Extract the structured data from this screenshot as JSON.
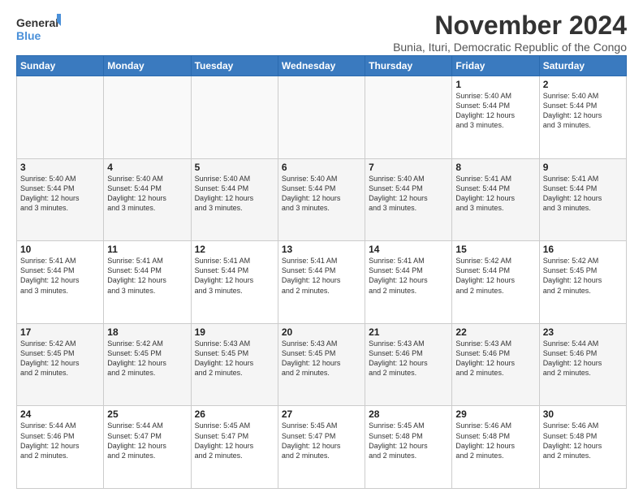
{
  "logo": {
    "line1": "General",
    "line2": "Blue"
  },
  "title": "November 2024",
  "subtitle": "Bunia, Ituri, Democratic Republic of the Congo",
  "days_of_week": [
    "Sunday",
    "Monday",
    "Tuesday",
    "Wednesday",
    "Thursday",
    "Friday",
    "Saturday"
  ],
  "weeks": [
    [
      {
        "day": "",
        "info": ""
      },
      {
        "day": "",
        "info": ""
      },
      {
        "day": "",
        "info": ""
      },
      {
        "day": "",
        "info": ""
      },
      {
        "day": "",
        "info": ""
      },
      {
        "day": "1",
        "info": "Sunrise: 5:40 AM\nSunset: 5:44 PM\nDaylight: 12 hours\nand 3 minutes."
      },
      {
        "day": "2",
        "info": "Sunrise: 5:40 AM\nSunset: 5:44 PM\nDaylight: 12 hours\nand 3 minutes."
      }
    ],
    [
      {
        "day": "3",
        "info": "Sunrise: 5:40 AM\nSunset: 5:44 PM\nDaylight: 12 hours\nand 3 minutes."
      },
      {
        "day": "4",
        "info": "Sunrise: 5:40 AM\nSunset: 5:44 PM\nDaylight: 12 hours\nand 3 minutes."
      },
      {
        "day": "5",
        "info": "Sunrise: 5:40 AM\nSunset: 5:44 PM\nDaylight: 12 hours\nand 3 minutes."
      },
      {
        "day": "6",
        "info": "Sunrise: 5:40 AM\nSunset: 5:44 PM\nDaylight: 12 hours\nand 3 minutes."
      },
      {
        "day": "7",
        "info": "Sunrise: 5:40 AM\nSunset: 5:44 PM\nDaylight: 12 hours\nand 3 minutes."
      },
      {
        "day": "8",
        "info": "Sunrise: 5:41 AM\nSunset: 5:44 PM\nDaylight: 12 hours\nand 3 minutes."
      },
      {
        "day": "9",
        "info": "Sunrise: 5:41 AM\nSunset: 5:44 PM\nDaylight: 12 hours\nand 3 minutes."
      }
    ],
    [
      {
        "day": "10",
        "info": "Sunrise: 5:41 AM\nSunset: 5:44 PM\nDaylight: 12 hours\nand 3 minutes."
      },
      {
        "day": "11",
        "info": "Sunrise: 5:41 AM\nSunset: 5:44 PM\nDaylight: 12 hours\nand 3 minutes."
      },
      {
        "day": "12",
        "info": "Sunrise: 5:41 AM\nSunset: 5:44 PM\nDaylight: 12 hours\nand 3 minutes."
      },
      {
        "day": "13",
        "info": "Sunrise: 5:41 AM\nSunset: 5:44 PM\nDaylight: 12 hours\nand 2 minutes."
      },
      {
        "day": "14",
        "info": "Sunrise: 5:41 AM\nSunset: 5:44 PM\nDaylight: 12 hours\nand 2 minutes."
      },
      {
        "day": "15",
        "info": "Sunrise: 5:42 AM\nSunset: 5:44 PM\nDaylight: 12 hours\nand 2 minutes."
      },
      {
        "day": "16",
        "info": "Sunrise: 5:42 AM\nSunset: 5:45 PM\nDaylight: 12 hours\nand 2 minutes."
      }
    ],
    [
      {
        "day": "17",
        "info": "Sunrise: 5:42 AM\nSunset: 5:45 PM\nDaylight: 12 hours\nand 2 minutes."
      },
      {
        "day": "18",
        "info": "Sunrise: 5:42 AM\nSunset: 5:45 PM\nDaylight: 12 hours\nand 2 minutes."
      },
      {
        "day": "19",
        "info": "Sunrise: 5:43 AM\nSunset: 5:45 PM\nDaylight: 12 hours\nand 2 minutes."
      },
      {
        "day": "20",
        "info": "Sunrise: 5:43 AM\nSunset: 5:45 PM\nDaylight: 12 hours\nand 2 minutes."
      },
      {
        "day": "21",
        "info": "Sunrise: 5:43 AM\nSunset: 5:46 PM\nDaylight: 12 hours\nand 2 minutes."
      },
      {
        "day": "22",
        "info": "Sunrise: 5:43 AM\nSunset: 5:46 PM\nDaylight: 12 hours\nand 2 minutes."
      },
      {
        "day": "23",
        "info": "Sunrise: 5:44 AM\nSunset: 5:46 PM\nDaylight: 12 hours\nand 2 minutes."
      }
    ],
    [
      {
        "day": "24",
        "info": "Sunrise: 5:44 AM\nSunset: 5:46 PM\nDaylight: 12 hours\nand 2 minutes."
      },
      {
        "day": "25",
        "info": "Sunrise: 5:44 AM\nSunset: 5:47 PM\nDaylight: 12 hours\nand 2 minutes."
      },
      {
        "day": "26",
        "info": "Sunrise: 5:45 AM\nSunset: 5:47 PM\nDaylight: 12 hours\nand 2 minutes."
      },
      {
        "day": "27",
        "info": "Sunrise: 5:45 AM\nSunset: 5:47 PM\nDaylight: 12 hours\nand 2 minutes."
      },
      {
        "day": "28",
        "info": "Sunrise: 5:45 AM\nSunset: 5:48 PM\nDaylight: 12 hours\nand 2 minutes."
      },
      {
        "day": "29",
        "info": "Sunrise: 5:46 AM\nSunset: 5:48 PM\nDaylight: 12 hours\nand 2 minutes."
      },
      {
        "day": "30",
        "info": "Sunrise: 5:46 AM\nSunset: 5:48 PM\nDaylight: 12 hours\nand 2 minutes."
      }
    ]
  ]
}
